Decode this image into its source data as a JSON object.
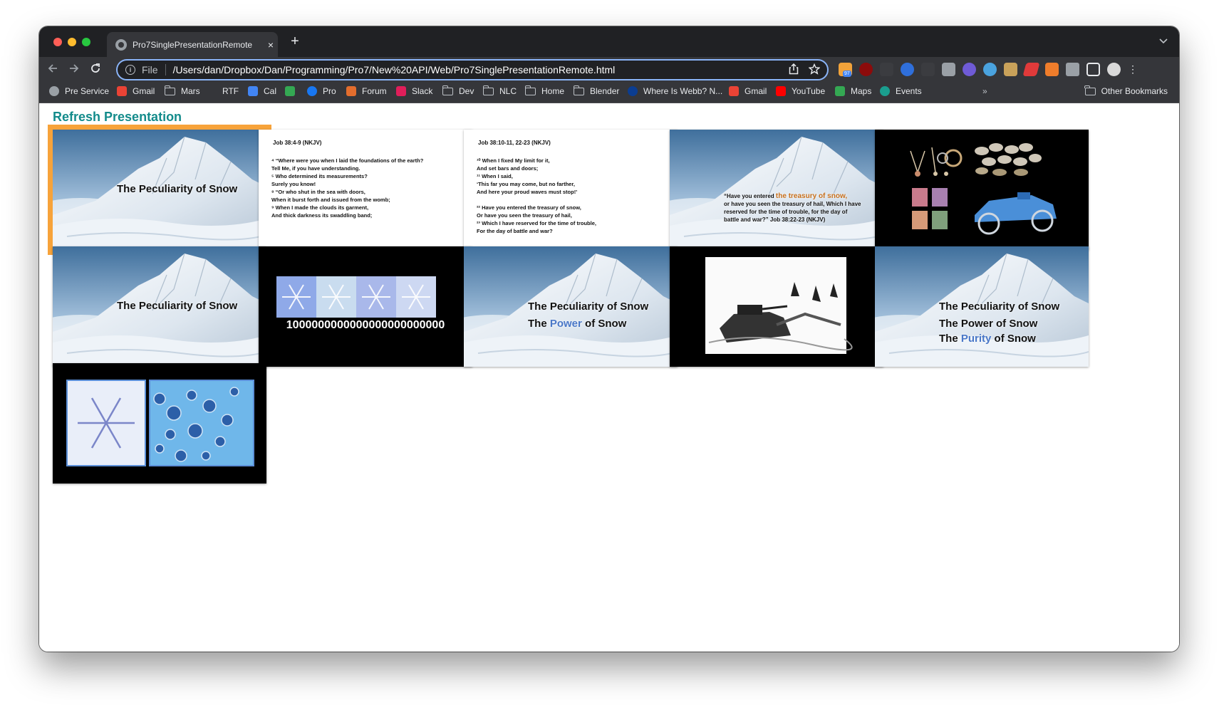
{
  "browser": {
    "tab_title": "Pro7SinglePresentationRemote",
    "tab_close": "×",
    "new_tab": "+",
    "url_scheme": "File",
    "url": "/Users/dan/Dropbox/Dan/Programming/Pro7/New%20API/Web/Pro7SinglePresentationRemote.html",
    "extension_badge": "97",
    "overflow_chevron": "»"
  },
  "bookmarks": [
    {
      "label": "Pre Service",
      "icon": "globe-icon"
    },
    {
      "label": "Gmail",
      "icon": "gmail-icon"
    },
    {
      "label": "Mars",
      "icon": "folder-icon"
    },
    {
      "label": "RTF",
      "icon": "none"
    },
    {
      "label": "Cal",
      "icon": "calendar-icon"
    },
    {
      "label": "",
      "icon": "google-drive-icon"
    },
    {
      "label": "Pro",
      "icon": "facebook-icon"
    },
    {
      "label": "Forum",
      "icon": "forum-icon"
    },
    {
      "label": "Slack",
      "icon": "slack-icon"
    },
    {
      "label": "Dev",
      "icon": "folder-icon"
    },
    {
      "label": "NLC",
      "icon": "folder-icon"
    },
    {
      "label": "Home",
      "icon": "folder-icon"
    },
    {
      "label": "Blender",
      "icon": "folder-icon"
    },
    {
      "label": "Where Is Webb? N...",
      "icon": "nasa-icon"
    },
    {
      "label": "Gmail",
      "icon": "gmail-icon"
    },
    {
      "label": "YouTube",
      "icon": "youtube-icon"
    },
    {
      "label": "Maps",
      "icon": "maps-icon"
    },
    {
      "label": "Events",
      "icon": "events-icon"
    }
  ],
  "other_bookmarks": "Other Bookmarks",
  "page": {
    "refresh_label": "Refresh Presentation"
  },
  "slides": [
    {
      "type": "title",
      "lines": [
        "The Peculiarity of Snow"
      ],
      "selected": true
    },
    {
      "type": "scripture",
      "reference": "Job 38:4-9 (NKJV)",
      "verses": [
        "⁴ “Where were you when I laid the foundations of the earth?",
        "Tell Me, if you have understanding.",
        "⁵ Who determined its measurements?",
        "Surely you know!",
        "⁸ “Or who shut in the sea with doors,",
        "When it burst forth and issued from the womb;",
        "⁹ When I made the clouds its garment,",
        "And thick darkness its swaddling band;"
      ]
    },
    {
      "type": "scripture",
      "reference": "Job 38:10-11, 22-23 (NKJV)",
      "verses": [
        "¹⁰ When I fixed My limit for it,",
        "And set bars and doors;",
        "¹¹ When I said,",
        "‘This far you may come, but no farther,",
        "And here your proud waves must stop!’",
        "",
        "²² Have you entered the treasury of snow,",
        "Or have you seen the treasury of hail,",
        "²³ Which I have reserved for the time of trouble,",
        "For the day of battle and war?"
      ]
    },
    {
      "type": "quote",
      "pre": "“Have you entered ",
      "highlight": "the treasury of snow,",
      "rest": [
        "or have you seen the treasury of hail, Which I have",
        "reserved for the time of trouble, for the day of",
        "battle and war?”    Job 38:22-23 (NKJV)"
      ],
      "highlight_color": "#c8701c"
    },
    {
      "type": "treasures"
    },
    {
      "type": "title",
      "lines": [
        "The Peculiarity of Snow"
      ]
    },
    {
      "type": "snowflakes",
      "caption": "1000000000000000000000000"
    },
    {
      "type": "title2",
      "line1": "The Peculiarity of Snow",
      "line2_pre": "The ",
      "line2_hl": "Power",
      "line2_post": " of Snow",
      "hl_color": "#4a78c8"
    },
    {
      "type": "tank"
    },
    {
      "type": "title3",
      "line1": "The Peculiarity of Snow",
      "line2": "The Power of Snow",
      "line3_pre": "The ",
      "line3_hl": "Purity",
      "line3_post": " of Snow",
      "hl_color": "#4a78c8"
    },
    {
      "type": "crystals"
    }
  ]
}
